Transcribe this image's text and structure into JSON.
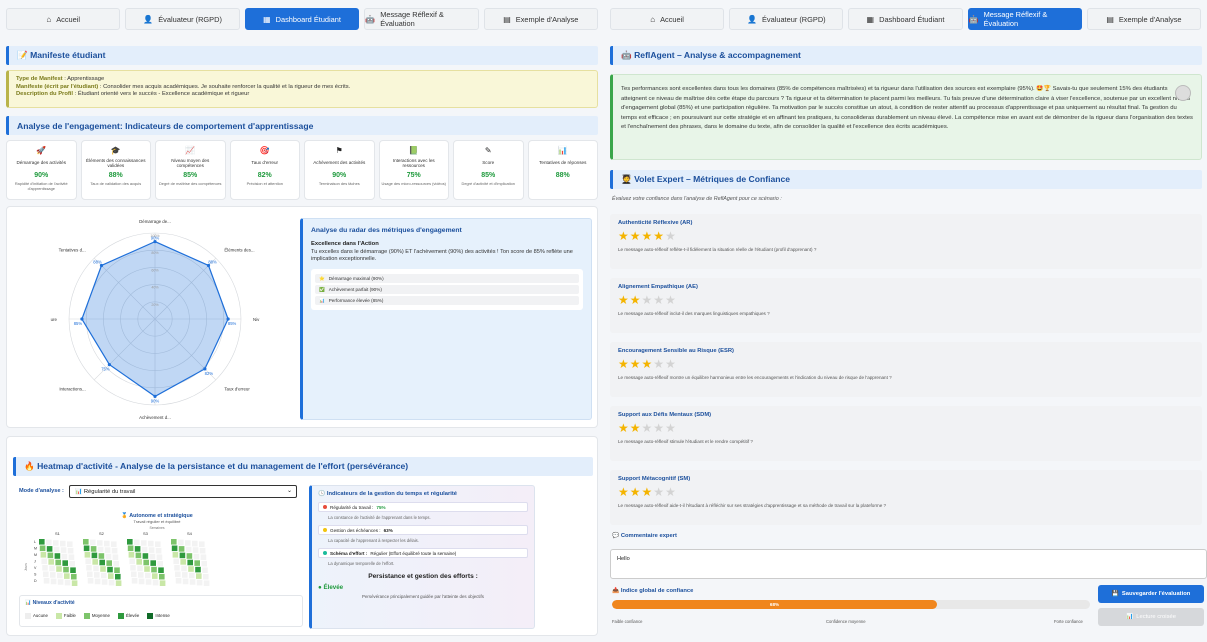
{
  "left": {
    "tabs": [
      {
        "icon": "⌂",
        "label": "Accueil"
      },
      {
        "icon": "👤",
        "label": "Évaluateur (RGPD)"
      },
      {
        "icon": "▦",
        "label": "Dashboard Étudiant"
      },
      {
        "icon": "🤖",
        "label": "Message Réflexif & Évaluation"
      },
      {
        "icon": "▤",
        "label": "Exemple d'Analyse"
      }
    ],
    "manifest_title": "📝 Manifeste étudiant",
    "manifest": {
      "type_label": "Type de Manifest",
      "type_value": " : Apprentissage",
      "manif_label": "Manifeste (écrit par l'étudiant)",
      "manif_value": " : Consolider mes acquis académiques. Je souhaite renforcer la qualité et la rigueur de mes écrits.",
      "profile_label": "Description du Profil",
      "profile_value": " : Étudiant orienté vers le succès - Excellence académique et rigueur"
    },
    "engagement_title": "Analyse de l'engagement: Indicateurs de comportement d'apprentissage",
    "metrics": [
      {
        "icon": "🚀",
        "title": "Démarrage des activités",
        "value": "90%",
        "desc": "Rapidité d'initiation de l'activité d'apprentissage"
      },
      {
        "icon": "🎓",
        "title": "Éléments des connaissances validées",
        "value": "88%",
        "desc": "Taux de validation des acquis"
      },
      {
        "icon": "📈",
        "title": "Niveau moyen des compétences",
        "value": "85%",
        "desc": "Degré de maîtrise des compétences"
      },
      {
        "icon": "🎯",
        "title": "Taux d'erreur",
        "value": "82%",
        "desc": "Précision et attention"
      },
      {
        "icon": "⚑",
        "title": "Achèvement des activités",
        "value": "90%",
        "desc": "Terminaison des tâches"
      },
      {
        "icon": "📗",
        "title": "Interactions avec les ressources",
        "value": "75%",
        "desc": "Usage des micro-ressources (vidéos)"
      },
      {
        "icon": "✎",
        "title": "Score",
        "value": "85%",
        "desc": "Degré d'activité et d'implication"
      },
      {
        "icon": "📊",
        "title": "Tentatives de réponses",
        "value": "88%",
        "desc": ""
      }
    ],
    "radar": {
      "axes": [
        "Démarrage de...",
        "Éléments des...",
        "Niv",
        "Taux d'erreur",
        "Achèvement d...",
        "Interactions...",
        "ure",
        "Tentatives d..."
      ],
      "values": [
        90,
        88,
        85,
        82,
        90,
        75,
        85,
        88
      ],
      "rings": [
        "100%",
        "80%",
        "60%",
        "40%",
        "20%"
      ]
    },
    "analysis": {
      "title": "Analyse du radar des métriques d'engagement",
      "subtitle": "Excellence dans l'Action",
      "text": "Tu excelles dans le démarrage (90%) ET l'achèvement (90%) des activités ! Ton score de 85% reflète une implication exceptionnelle.",
      "items": [
        {
          "icon": "⭐",
          "label": "Démarrage maximal (90%)"
        },
        {
          "icon": "✅",
          "label": "Achèvement parfait (90%)"
        },
        {
          "icon": "📊",
          "label": "Performance élevée (85%)"
        }
      ]
    },
    "heatmap_title": "🔥 Heatmap d'activité - Analyse de la persistance et du management de l'effort (persévérance)",
    "mode_label": "Mode d'analyse :",
    "mode_value": "📊 Régularité du travail",
    "heat_chart": {
      "title": "🏅 Autonome et stratégique",
      "subtitle": "Travail régulier et équilibré",
      "axis_top": "Semaines",
      "weeks": [
        "S1",
        "S2",
        "S3",
        "S4"
      ],
      "days": [
        "L",
        "M",
        "M",
        "J",
        "V",
        "S",
        "D"
      ],
      "ylabel": "Jours"
    },
    "legend": {
      "title": "Niveaux d'activité",
      "items": [
        {
          "label": "Aucune",
          "color": "#eeeeee"
        },
        {
          "label": "Faible",
          "color": "#c9e7a7"
        },
        {
          "label": "Moyenne",
          "color": "#7dc46b"
        },
        {
          "label": "Élevée",
          "color": "#2f9a3e"
        },
        {
          "label": "Intense",
          "color": "#106b28"
        }
      ]
    },
    "indicators": {
      "title": "Indicateurs de la gestion du temps et régularité",
      "items": [
        {
          "label": "Régularité du travail : ",
          "value": "75%",
          "desc": "La constance de l'activité de l'apprenant dans le temps.",
          "color": "#e74c3c"
        },
        {
          "label": "Gestion des échéances : ",
          "value": "63%",
          "desc": "La capacité de l'apprenant à respecter les délais.",
          "color": "#f1c40f"
        },
        {
          "label": "Schéma d'effort : ",
          "value": "Régulier (Effort équilibré toute la semaine)",
          "desc": "La dynamique temporelle de l'effort.",
          "color": "#1abc9c"
        }
      ],
      "persist_title": "Persistance et gestion des efforts :",
      "level": "Élevée",
      "level_desc": "Persévérance principalement guidée par l'atteinte des objectifs"
    }
  },
  "right": {
    "tabs": [
      {
        "icon": "⌂",
        "label": "Accueil"
      },
      {
        "icon": "👤",
        "label": "Évaluateur (RGPD)"
      },
      {
        "icon": "▦",
        "label": "Dashboard Étudiant"
      },
      {
        "icon": "🤖",
        "label": "Message Réflexif & Évaluation"
      },
      {
        "icon": "▤",
        "label": "Exemple d'Analyse"
      }
    ],
    "agent_title": "🤖 ReflAgent – Analyse & accompagnement",
    "message": "Tes performances sont excellentes dans tous les domaines (85% de compétences maîtrisées) et ta rigueur dans l'utilisation des sources est exemplaire (95%). 🤩🏆 Savais-tu que seulement 15% des étudiants atteignent ce niveau de maîtrise dès cette étape du parcours ? Ta rigueur et ta détermination te placent parmi les meilleurs. Tu fais preuve d'une détermination claire à viser l'excellence, soutenue par un excellent niveau d'engagement global (85%) et une participation régulière. Ta motivation par le succès constitue un atout, à condition de rester attentif au processus d'apprentissage et pas uniquement au résultat final. Ta gestion du temps est efficace ; en poursuivant sur cette stratégie et en affinant tes pratiques, tu consolideras durablement un niveau élevé. La compétence mise en avant est de démontrer de la rigueur dans l'organisation des textes et l'enchaînement des phrases, dans le domaine du texte, afin de consolider la qualité et l'excellence des écrits académiques.",
    "expert_title": "🧑‍🎓 Volet Expert – Métriques de Confiance",
    "eval_intro": "Évaluez votre confiance dans l'analyse de ReflAgent pour ce scénario :",
    "criteria": [
      {
        "title": "Authenticité Réflexive (AR)",
        "stars": 4,
        "question": "Le message auto-réflexif reflète-t-il fidèlement la situation réelle de l'étudiant (profil d'apprenant) ?"
      },
      {
        "title": "Alignement Empathique (AE)",
        "stars": 2,
        "question": "Le message auto-réflexif inclut-il des marques linguistiques empathiques ?"
      },
      {
        "title": "Encouragement Sensible au Risque (ESR)",
        "stars": 3,
        "question": "Le message auto-réflexif montre un équilibre harmonieux entre les encouragements et l'indication du niveau de risque de l'apprenant ?"
      },
      {
        "title": "Support aux Défis Mentaux (SDM)",
        "stars": 2,
        "question": "Le message auto-réflexif stimule l'étudiant et le rendre compétitif ?"
      },
      {
        "title": "Support Métacognitif (SM)",
        "stars": 3,
        "question": "Le message auto-réflexif aide-t-il l'étudiant à réfléchir sur ses stratégies d'apprentissage et sa méthode de travail sur la plateforme ?"
      }
    ],
    "comment_label": "💬 Commentaire expert",
    "comment_value": "Hello",
    "global_label": "📤 Indice global de confiance",
    "global_value": "68%",
    "global_fraction": 0.68,
    "scale": [
      "Faible confiance",
      "Confidence moyenne",
      "Forte confiance"
    ],
    "save_label": "Sauvegarder l'évaluation",
    "cross_label": "Lecture croisée",
    "accent_color": "#1e6fd9",
    "gauge_color": "#f0861d"
  }
}
